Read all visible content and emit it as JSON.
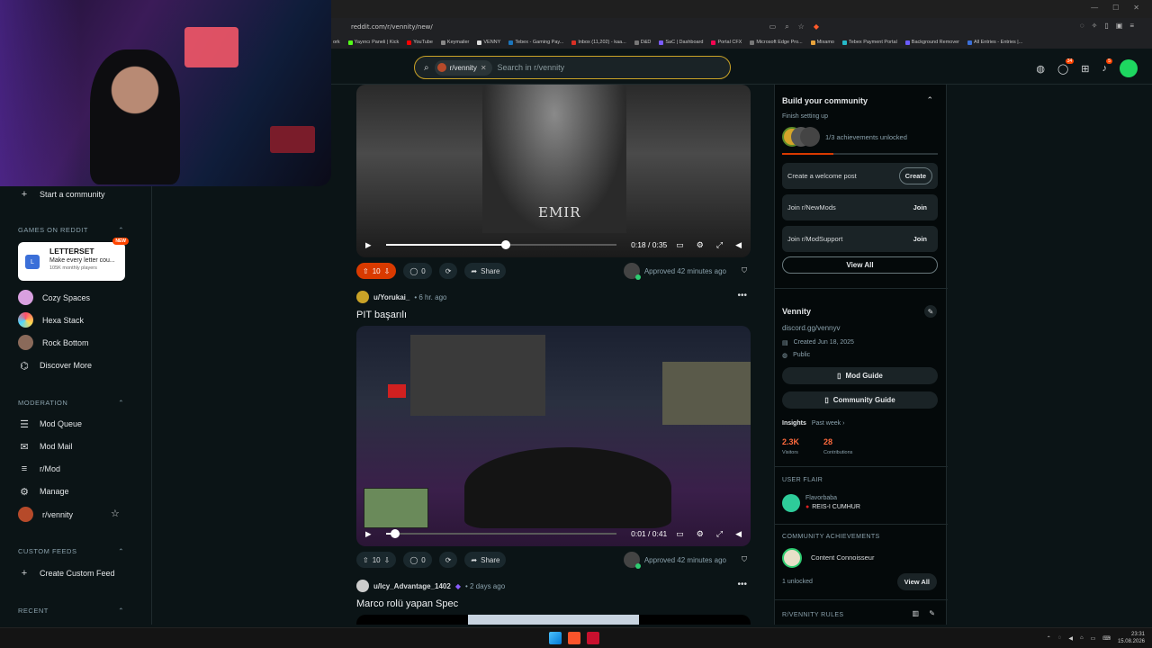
{
  "browser": {
    "url": "reddit.com/r/vennity/new/",
    "bookmarks": [
      "ork",
      "Yayıncı Paneli | Kick",
      "YouTube",
      "Keymailer",
      "VENNY",
      "Tebex - Gaming Pay...",
      "Inbox (11,202) - kaa...",
      "D&D",
      "SaC | Dashboard",
      "Portal CFX",
      "Microsoft Edge Pro...",
      "Mixamo",
      "Tebex Payment Portal",
      "Background Remover",
      "All Entries - Entries |..."
    ]
  },
  "header": {
    "chip_label": "r/vennity",
    "search_placeholder": "Search in r/vennity",
    "chat_badge": "34",
    "notif_badge": "5"
  },
  "sidebar": {
    "start_community": "Start a community",
    "games_header": "GAMES ON REDDIT",
    "letterset": {
      "title": "LETTERSET",
      "subtitle": "Make every letter cou...",
      "meta": "105K monthly players",
      "tag": "NEW"
    },
    "games": [
      "Cozy Spaces",
      "Hexa Stack",
      "Rock Bottom",
      "Discover More"
    ],
    "moderation_header": "MODERATION",
    "moderation": [
      "Mod Queue",
      "Mod Mail",
      "r/Mod",
      "Manage",
      "r/vennity"
    ],
    "custom_feeds_header": "CUSTOM FEEDS",
    "create_feed": "Create Custom Feed",
    "recent_header": "RECENT"
  },
  "posts": [
    {
      "video_overlay": "EMIR",
      "time": "0:18 / 0:35",
      "progress": 0.52,
      "votes": "10",
      "comments": "0",
      "share": "Share",
      "approved": "Approved 42 minutes ago"
    },
    {
      "user": "u/Yorukai_",
      "age": "• 6 hr. ago",
      "title": "PIT başarılı",
      "time": "0:01 / 0:41",
      "progress": 0.04,
      "votes": "10",
      "comments": "0",
      "share": "Share",
      "approved": "Approved 42 minutes ago"
    },
    {
      "user": "u/Icy_Advantage_1402",
      "age": "• 2 days ago",
      "title": "Marco rolü yapan Spec"
    }
  ],
  "right": {
    "build_title": "Build your community",
    "finish": "Finish setting up",
    "achievements": "1/3 achievements unlocked",
    "tasks": [
      {
        "label": "Create a welcome post",
        "btn": "Create"
      },
      {
        "label": "Join r/NewMods",
        "btn": "Join"
      },
      {
        "label": "Join r/ModSupport",
        "btn": "Join"
      }
    ],
    "view_all": "View All",
    "name": "Vennity",
    "discord": "discord.gg/vennyv",
    "created": "Created Jun 18, 2025",
    "public": "Public",
    "mod_guide": "Mod Guide",
    "community_guide": "Community Guide",
    "insights": "Insights",
    "past_week": "Past week ›",
    "visitors_val": "2.3K",
    "visitors_label": "Visitors",
    "contrib_val": "28",
    "contrib_label": "Contributions",
    "user_flair_head": "USER FLAIR",
    "flair_user": "Flavorbaba",
    "flair_text": "REIS-I CUMHUR",
    "achievements_head": "COMMUNITY ACHIEVEMENTS",
    "achievement_name": "Content Connoisseur",
    "unlocked": "1 unlocked",
    "view_all2": "View All",
    "rules_head": "R/VENNITY RULES"
  },
  "taskbar": {
    "time": "23:31",
    "date": "15.08.2026"
  },
  "colors": {
    "accent": "#ff4500",
    "bg": "#0b1416",
    "search_border": "#c9a227"
  }
}
